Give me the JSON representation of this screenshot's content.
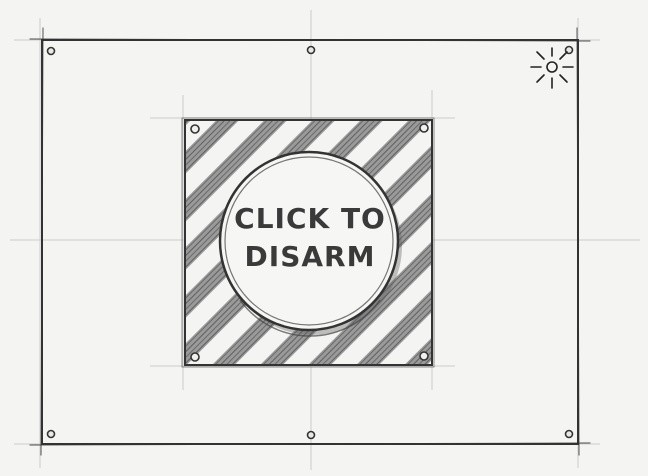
{
  "button": {
    "line1": "CLICK TO",
    "line2": "DISARM"
  },
  "icons": {
    "corner_light": "sun-light-icon"
  },
  "colors": {
    "paper": "#f4f4f2",
    "ink": "#333333",
    "guide": "#c9c9c9",
    "hatch": "#7a7a7a"
  }
}
